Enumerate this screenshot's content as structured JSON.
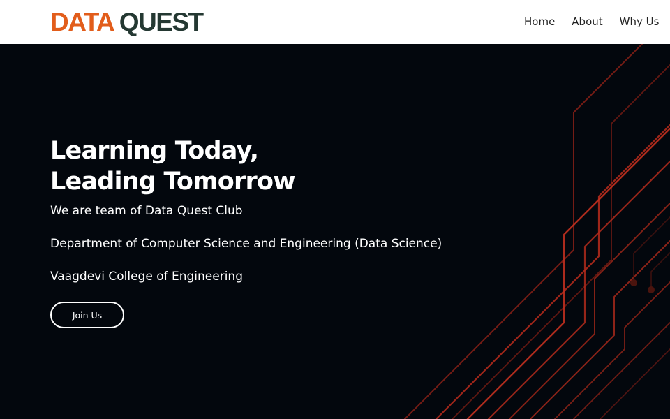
{
  "brand": {
    "part1": "DATA",
    "part2": "QUEST",
    "color1": "#e25d1b",
    "color2": "#243832"
  },
  "nav": {
    "items": [
      "Home",
      "About",
      "Why Us"
    ]
  },
  "hero": {
    "headline_line1": "Learning Today,",
    "headline_line2": "Leading Tomorrow",
    "sub1": "We are team of Data Quest Club",
    "sub2": "Department of Computer Science and Engineering (Data Science)",
    "sub3": "Vaagdevi College of Engineering",
    "cta_label": "Join Us",
    "background_color": "#03070d",
    "accent_line_color": "#b02a1c"
  }
}
